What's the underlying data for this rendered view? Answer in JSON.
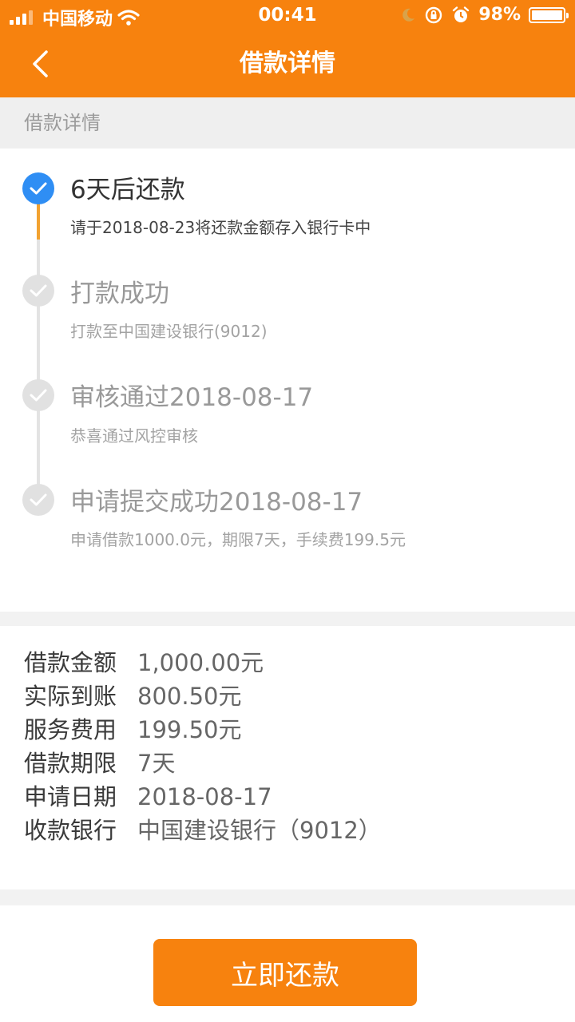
{
  "status_bar": {
    "carrier": "中国移动",
    "time": "00:41",
    "battery": "98%"
  },
  "nav": {
    "title": "借款详情"
  },
  "section_label": "借款详情",
  "timeline": [
    {
      "title": "6天后还款",
      "subtitle": "请于2018-08-23将还款金额存入银行卡中",
      "state": "active"
    },
    {
      "title": "打款成功",
      "subtitle": "打款至中国建设银行(9012)",
      "state": "done"
    },
    {
      "title": "审核通过2018-08-17",
      "subtitle": "恭喜通过风控审核",
      "state": "done"
    },
    {
      "title": "申请提交成功2018-08-17",
      "subtitle": "申请借款1000.0元，期限7天，手续费199.5元",
      "state": "done"
    }
  ],
  "details": [
    {
      "label": "借款金额",
      "value": "1,000.00元"
    },
    {
      "label": "实际到账",
      "value": "800.50元"
    },
    {
      "label": "服务费用",
      "value": "199.50元"
    },
    {
      "label": "借款期限",
      "value": "7天"
    },
    {
      "label": "申请日期",
      "value": "2018-08-17"
    },
    {
      "label": "收款银行",
      "value": "中国建设银行（9012）"
    }
  ],
  "actions": {
    "repay_label": "立即还款"
  },
  "colors": {
    "brand_orange": "#f7820e",
    "active_blue": "#2f8ef4",
    "inactive_gray": "#e1e1e1"
  }
}
